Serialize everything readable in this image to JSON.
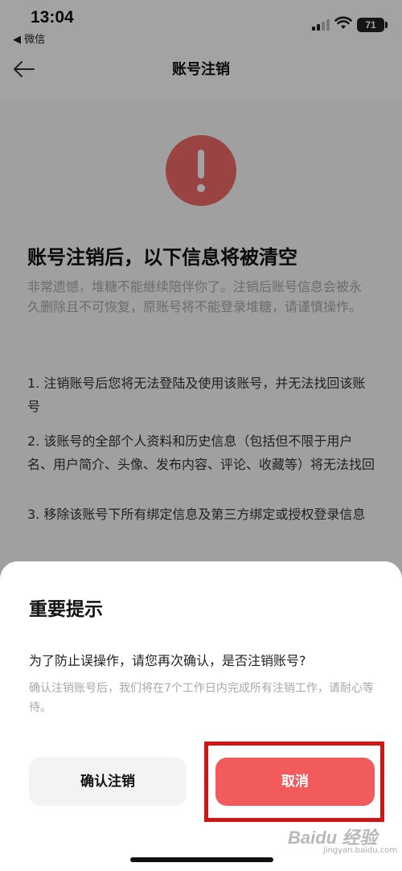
{
  "status_bar": {
    "time": "13:04",
    "back_app": "◀ 微信",
    "battery": "71"
  },
  "nav": {
    "title": "账号注销"
  },
  "content": {
    "headline": "账号注销后，以下信息将被清空",
    "description": "非常遗憾，堆糖不能继续陪伴你了。注销后账号信息会被永久删除且不可恢复，原账号将不能登录堆糖，请谨慎操作。",
    "items": [
      "1. 注销账号后您将无法登陆及使用该账号，并无法找回该账号",
      "2. 该账号的全部个人资料和历史信息（包括但不限于用户名、用户简介、头像、发布内容、评论、收藏等）将无法找回",
      "3. 移除该账号下所有绑定信息及第三方绑定或授权登录信息"
    ]
  },
  "dialog": {
    "title": "重要提示",
    "question": "为了防止误操作，请您再次确认，是否注销账号?",
    "note": "确认注销账号后，我们将在7个工作日内完成所有注销工作，请耐心等待。",
    "confirm_label": "确认注销",
    "cancel_label": "取消"
  },
  "watermark": {
    "text": "Baidu 经验",
    "sub": "jingyan.baidu.com"
  },
  "colors": {
    "accent_red": "#f25b5b",
    "alert_red": "#f16a6a",
    "highlight_frame": "#d11414"
  }
}
